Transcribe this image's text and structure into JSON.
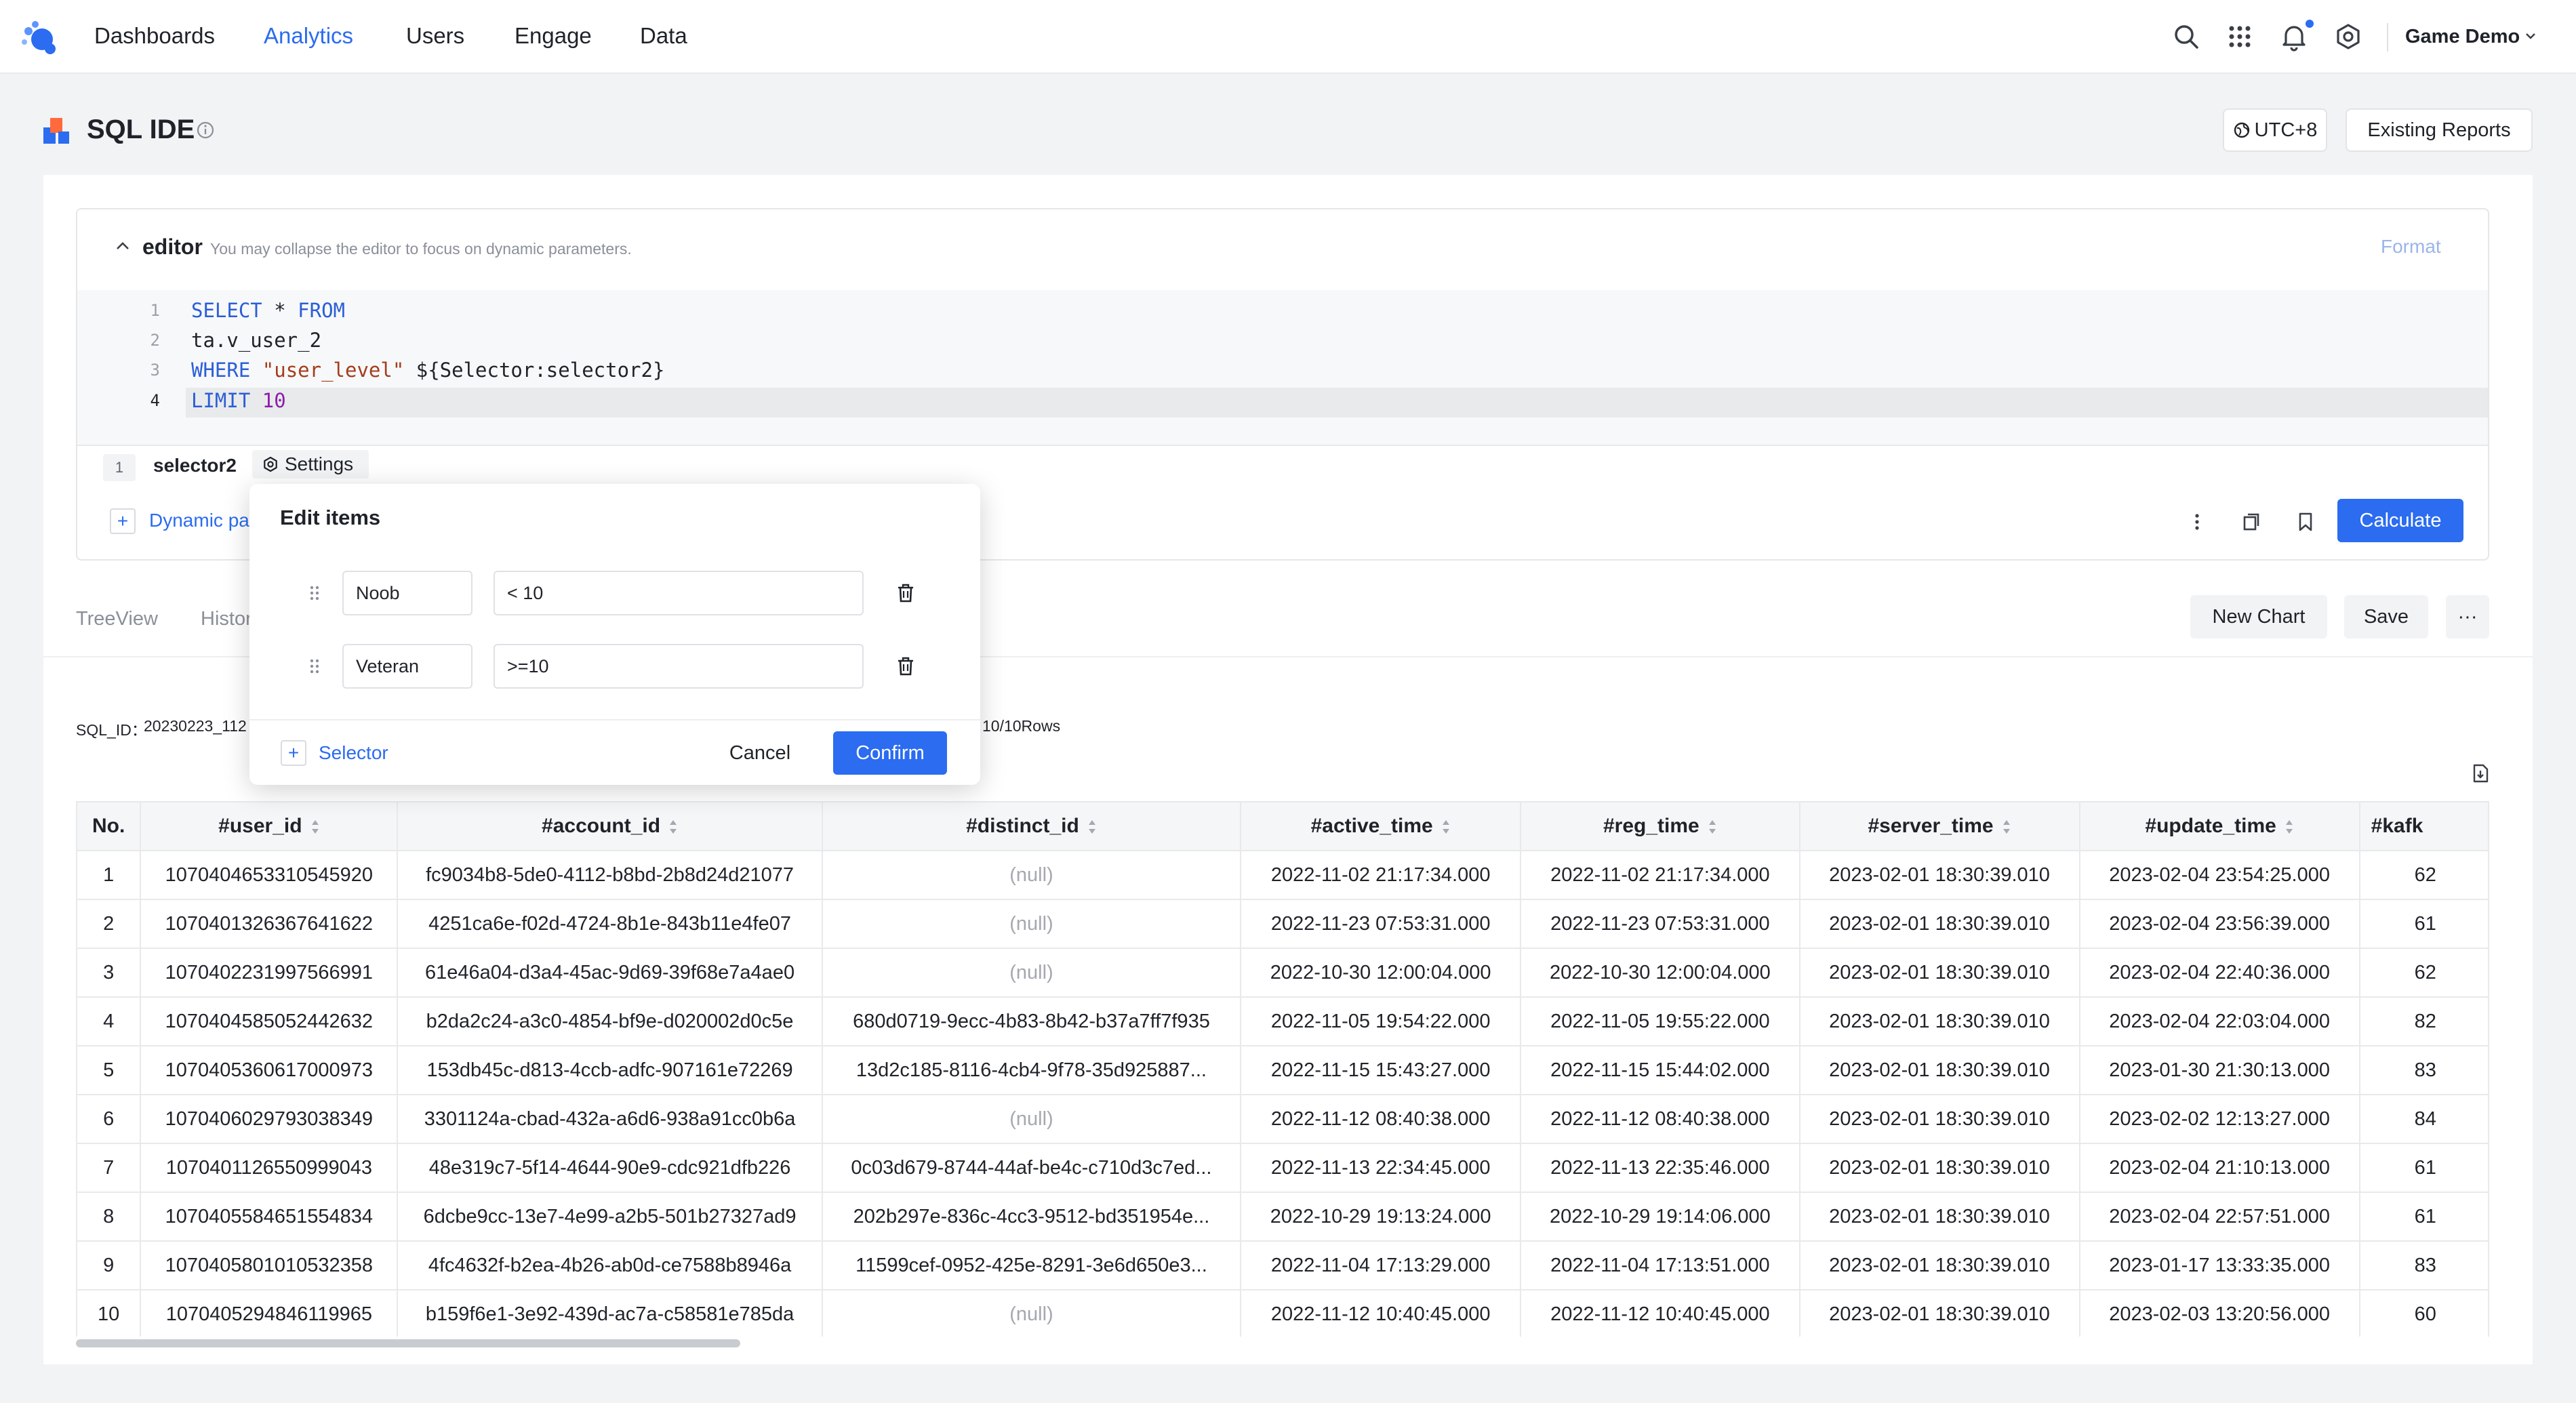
{
  "nav": {
    "items": [
      "Dashboards",
      "Analytics",
      "Users",
      "Engage",
      "Data"
    ],
    "active": "Analytics",
    "project": "Game Demo",
    "icons": [
      "search-icon",
      "apps-grid-icon",
      "bell-icon",
      "settings-icon"
    ]
  },
  "header": {
    "title": "SQL IDE",
    "timezone": "UTC+8",
    "existing_reports": "Existing Reports"
  },
  "editor": {
    "title": "editor",
    "hint": "You may collapse the editor to focus on dynamic parameters.",
    "format": "Format",
    "line_numbers": [
      "1",
      "2",
      "3",
      "4"
    ],
    "lines": {
      "l1_kw1": "SELECT",
      "l1_rest": " * ",
      "l1_kw2": "FROM",
      "l2": "ta.v_user_2",
      "l3_kw": "WHERE",
      "l3_str": "\"user_level\"",
      "l3_rest": " ${Selector:selector2}",
      "l4_kw": "LIMIT",
      "l4_num": "10"
    }
  },
  "params": {
    "index": "1",
    "name": "selector2",
    "settings": "Settings",
    "dynamic": "Dynamic parameter"
  },
  "toolbar": {
    "calculate": "Calculate"
  },
  "tabs": {
    "treeview": "TreeView",
    "history": "History",
    "new_chart": "New Chart",
    "save": "Save",
    "more": "···"
  },
  "result": {
    "sql_id_label": "SQL_ID：",
    "sql_id_value": "20230223_112",
    "rows": "10/10Rows"
  },
  "popover": {
    "title": "Edit items",
    "items": [
      {
        "name": "Noob",
        "value": "< 10"
      },
      {
        "name": "Veteran",
        "value": ">=10"
      }
    ],
    "add_selector": "Selector",
    "cancel": "Cancel",
    "confirm": "Confirm"
  },
  "table": {
    "columns": [
      "No.",
      "#user_id",
      "#account_id",
      "#distinct_id",
      "#active_time",
      "#reg_time",
      "#server_time",
      "#update_time",
      "#kafk"
    ],
    "rows": [
      [
        "1",
        "1070404653310545920",
        "fc9034b8-5de0-4112-b8bd-2b8d24d21077",
        "(null)",
        "2022-11-02 21:17:34.000",
        "2022-11-02 21:17:34.000",
        "2023-02-01 18:30:39.010",
        "2023-02-04 23:54:25.000",
        "62"
      ],
      [
        "2",
        "1070401326367641622",
        "4251ca6e-f02d-4724-8b1e-843b11e4fe07",
        "(null)",
        "2022-11-23 07:53:31.000",
        "2022-11-23 07:53:31.000",
        "2023-02-01 18:30:39.010",
        "2023-02-04 23:56:39.000",
        "61"
      ],
      [
        "3",
        "1070402231997566991",
        "61e46a04-d3a4-45ac-9d69-39f68e7a4ae0",
        "(null)",
        "2022-10-30 12:00:04.000",
        "2022-10-30 12:00:04.000",
        "2023-02-01 18:30:39.010",
        "2023-02-04 22:40:36.000",
        "62"
      ],
      [
        "4",
        "1070404585052442632",
        "b2da2c24-a3c0-4854-bf9e-d020002d0c5e",
        "680d0719-9ecc-4b83-8b42-b37a7ff7f935",
        "2022-11-05 19:54:22.000",
        "2022-11-05 19:55:22.000",
        "2023-02-01 18:30:39.010",
        "2023-02-04 22:03:04.000",
        "82"
      ],
      [
        "5",
        "1070405360617000973",
        "153db45c-d813-4ccb-adfc-907161e72269",
        "13d2c185-8116-4cb4-9f78-35d925887...",
        "2022-11-15 15:43:27.000",
        "2022-11-15 15:44:02.000",
        "2023-02-01 18:30:39.010",
        "2023-01-30 21:30:13.000",
        "83"
      ],
      [
        "6",
        "1070406029793038349",
        "3301124a-cbad-432a-a6d6-938a91cc0b6a",
        "(null)",
        "2022-11-12 08:40:38.000",
        "2022-11-12 08:40:38.000",
        "2023-02-01 18:30:39.010",
        "2023-02-02 12:13:27.000",
        "84"
      ],
      [
        "7",
        "1070401126550999043",
        "48e319c7-5f14-4644-90e9-cdc921dfb226",
        "0c03d679-8744-44af-be4c-c710d3c7ed...",
        "2022-11-13 22:34:45.000",
        "2022-11-13 22:35:46.000",
        "2023-02-01 18:30:39.010",
        "2023-02-04 21:10:13.000",
        "61"
      ],
      [
        "8",
        "1070405584651554834",
        "6dcbe9cc-13e7-4e99-a2b5-501b27327ad9",
        "202b297e-836c-4cc3-9512-bd351954e...",
        "2022-10-29 19:13:24.000",
        "2022-10-29 19:14:06.000",
        "2023-02-01 18:30:39.010",
        "2023-02-04 22:57:51.000",
        "61"
      ],
      [
        "9",
        "1070405801010532358",
        "4fc4632f-b2ea-4b26-ab0d-ce7588b8946a",
        "11599cef-0952-425e-8291-3e6d650e3...",
        "2022-11-04 17:13:29.000",
        "2022-11-04 17:13:51.000",
        "2023-02-01 18:30:39.010",
        "2023-01-17 13:33:35.000",
        "83"
      ],
      [
        "10",
        "1070405294846119965",
        "b159f6e1-3e92-439d-ac7a-c58581e785da",
        "(null)",
        "2022-11-12 10:40:45.000",
        "2022-11-12 10:40:45.000",
        "2023-02-01 18:30:39.010",
        "2023-02-03 13:20:56.000",
        "60"
      ]
    ]
  },
  "colors": {
    "accent": "#2b6cf0",
    "null_text": "#a4a8af"
  }
}
